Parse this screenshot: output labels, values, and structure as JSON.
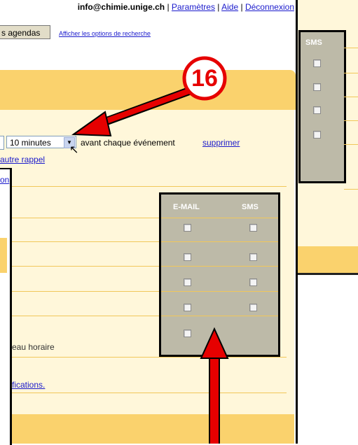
{
  "topbar": {
    "email": "info@chimie.unige.ch",
    "sep": "|",
    "settings": "Paramètres",
    "help": "Aide",
    "logout": "Déconnexion"
  },
  "toolbar": {
    "agendas_button": "s agendas",
    "search_options": "Afficher les options de recherche"
  },
  "back_panel": {
    "sms_header": "SMS"
  },
  "reminder": {
    "select_value": "10 minutes",
    "before_text": "avant chaque événement",
    "delete_link": "supprimer",
    "add_link": "autre rappel",
    "partial_link": "on"
  },
  "annotation_number": "16",
  "notifications": {
    "email_header": "E-MAIL",
    "sms_header": "SMS",
    "partial_slot": "eau horaire",
    "partial_link": "fications."
  },
  "colors": {
    "accent_yellow": "#fad26d",
    "light_yellow": "#fff7da",
    "panel_gray": "#bdbaa8",
    "arrow_red": "#e60000",
    "link_blue": "#1a1acc"
  }
}
